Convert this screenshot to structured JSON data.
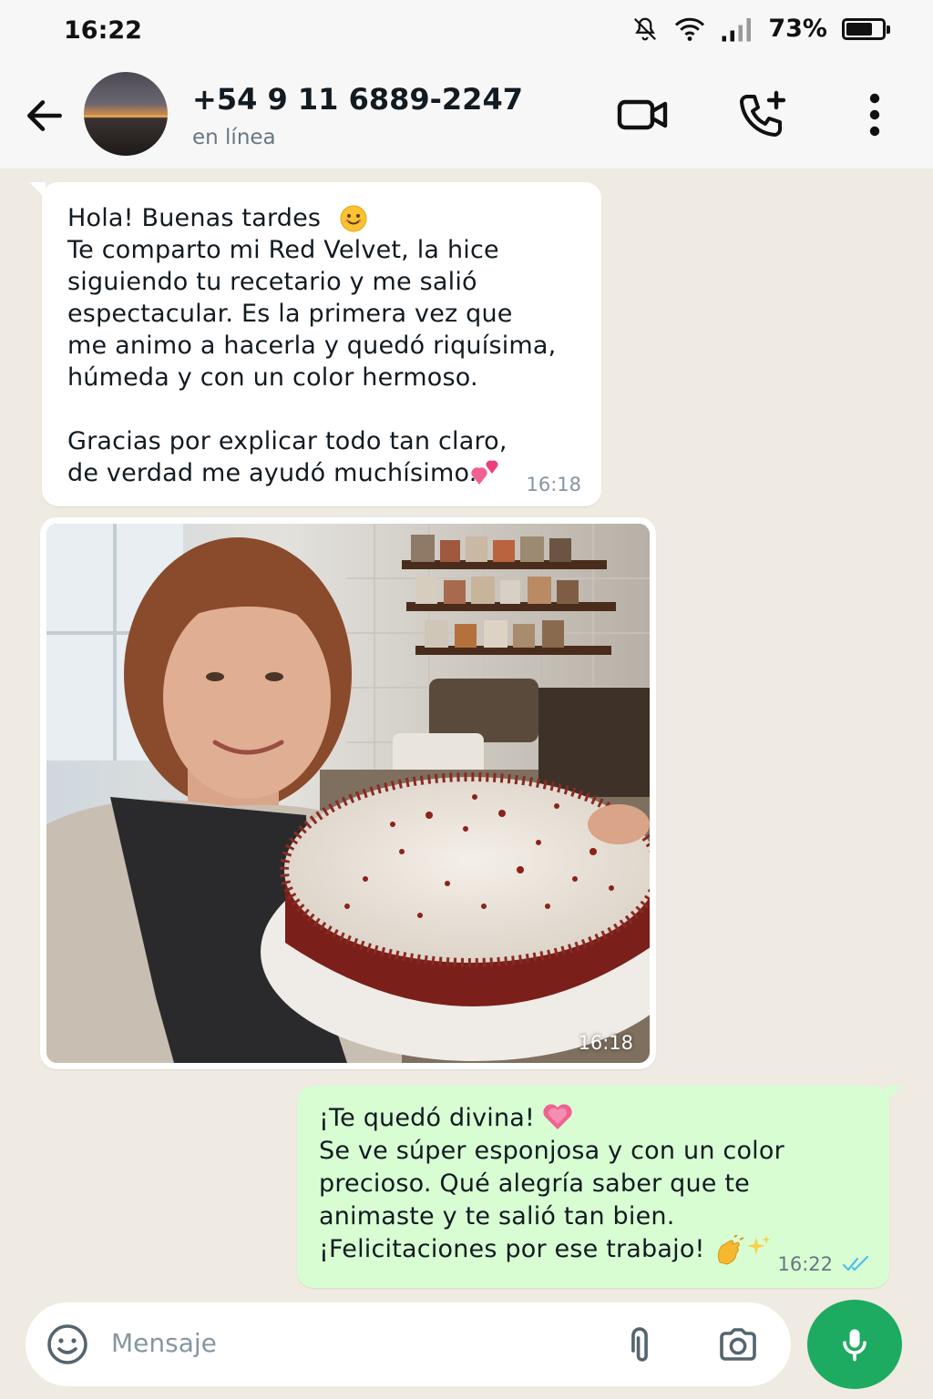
{
  "status_bar": {
    "time": "16:22",
    "battery_text": "73%",
    "battery_level": 0.73,
    "icons": [
      "bell-off-icon",
      "wifi-icon",
      "signal-icon",
      "battery-icon"
    ]
  },
  "header": {
    "contact_name": "+54 9 11 6889-2247",
    "contact_status": "en línea",
    "icons": [
      "back-arrow-icon",
      "video-call-icon",
      "add-call-icon",
      "more-vert-icon"
    ]
  },
  "messages": [
    {
      "direction": "incoming",
      "text_main": "Hola! Buenas tardes \nTe comparto mi Red Velvet, la hice\nsiguiendo tu recetario y me salió\nespectacular. Es la primera vez que\nme animo a hacerla y quedó riquísima,\nhúmeda y con un color hermoso.\n\nGracias por explicar todo tan claro,\nde verdad me ayudó muchísimo. ",
      "emojis": [
        "smiling-face",
        "two-hearts"
      ],
      "time": "16:18"
    },
    {
      "direction": "incoming",
      "type": "image",
      "image_subject": "woman-holding-red-velvet-cake",
      "time": "16:18"
    },
    {
      "direction": "outgoing",
      "text": "¡Te quedó divina! \nSe ve súper esponjosa y con un color\nprecioso. Qué alegría saber que te\nanimaste y te salió tan bien.\n¡Felicitaciones por ese trabajo! ",
      "emojis": [
        "growing-heart",
        "clapping-hands",
        "sparkles"
      ],
      "time": "16:22",
      "read_status": "read"
    }
  ],
  "composer": {
    "placeholder": "Mensaje",
    "icons": [
      "emoji-icon",
      "attach-icon",
      "camera-icon",
      "mic-icon"
    ]
  },
  "colors": {
    "background": "#efeae2",
    "outgoing_bubble": "#d9fdd3",
    "incoming_bubble": "#ffffff",
    "accent": "#1daa61",
    "read_ticks": "#53bdeb"
  }
}
